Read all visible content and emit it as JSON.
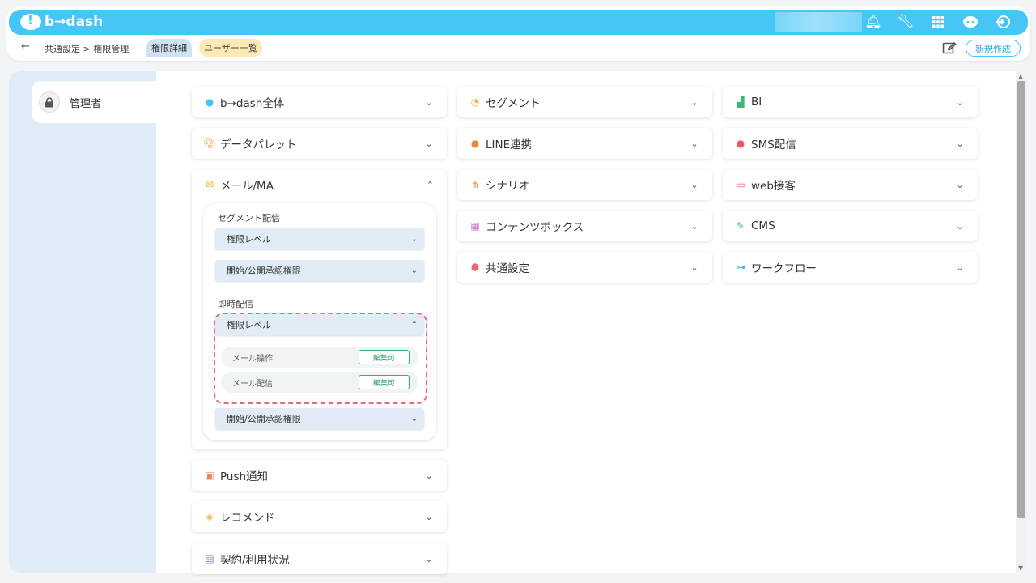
{
  "header": {
    "logo": "b→dash",
    "breadcrumb": "共通設定 > 権限管理",
    "tab_detail": "権限詳細",
    "tab_users": "ユーザー一覧",
    "new_button": "新規作成"
  },
  "sidebar": {
    "role": "管理者"
  },
  "categories": {
    "c1": "b→dash全体",
    "c2": "データパレット",
    "c3": "メール/MA",
    "c4": "Push通知",
    "c5": "レコメンド",
    "c6": "契約/利用状況",
    "c7": "セグメント",
    "c8": "LINE連携",
    "c9": "シナリオ",
    "c10": "コンテンツボックス",
    "c11": "共通設定",
    "c12": "BI",
    "c13": "SMS配信",
    "c14": "web接客",
    "c15": "CMS",
    "c16": "ワークフロー"
  },
  "mail_ma": {
    "segment_title": "セグメント配信",
    "immediate_title": "即時配信",
    "level_label": "権限レベル",
    "approve_label": "開始/公開承認権限",
    "perms": [
      {
        "label": "メール操作",
        "value": "編集可"
      },
      {
        "label": "メール配信",
        "value": "編集可"
      }
    ]
  },
  "colors": {
    "brand": "#46c6f6",
    "highlight": "#e86a7e",
    "badge": "#2bb673"
  }
}
